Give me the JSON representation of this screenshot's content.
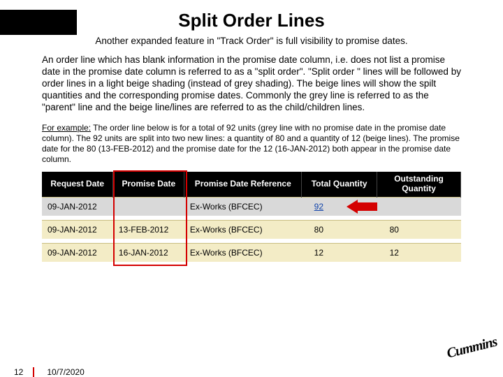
{
  "title": "Split Order Lines",
  "subtitle": "Another expanded feature in \"Track Order\" is full visibility to promise dates.",
  "body": "An order line which has blank information in the promise date column, i.e. does not list a promise date in the promise date column is referred to as a \"split order\". \"Split order \" lines will be followed by order lines in a light beige shading (instead of grey shading). The beige lines will show the spilt quantities and the corresponding promise dates. Commonly the grey line is referred to as the \"parent\" line and the beige line/lines are referred to as the child/children lines.",
  "example_label": "For example:",
  "example_text": " The order line below is for a total of 92 units (grey line with no promise date in the promise date column). The 92 units are split into two new lines: a quantity of 80 and a quantity of 12 (beige lines). The promise date for the 80 (13-FEB-2012) and the promise date for the 12 (16-JAN-2012) both appear in the promise date column.",
  "table": {
    "headers": {
      "request_date": "Request Date",
      "promise_date": "Promise Date",
      "promise_ref": "Promise Date Reference",
      "total_qty": "Total Quantity",
      "outstanding_qty": "Outstanding Quantity"
    },
    "rows": [
      {
        "kind": "parent",
        "request_date": "09-JAN-2012",
        "promise_date": "",
        "promise_ref": "Ex-Works (BFCEC)",
        "total_qty": "92",
        "outstanding_qty": ""
      },
      {
        "kind": "child",
        "request_date": "09-JAN-2012",
        "promise_date": "13-FEB-2012",
        "promise_ref": "Ex-Works (BFCEC)",
        "total_qty": "80",
        "outstanding_qty": "80"
      },
      {
        "kind": "child",
        "request_date": "09-JAN-2012",
        "promise_date": "16-JAN-2012",
        "promise_ref": "Ex-Works (BFCEC)",
        "total_qty": "12",
        "outstanding_qty": "12"
      }
    ]
  },
  "logo_text": "Cummins",
  "footer": {
    "page": "12",
    "date": "10/7/2020"
  }
}
